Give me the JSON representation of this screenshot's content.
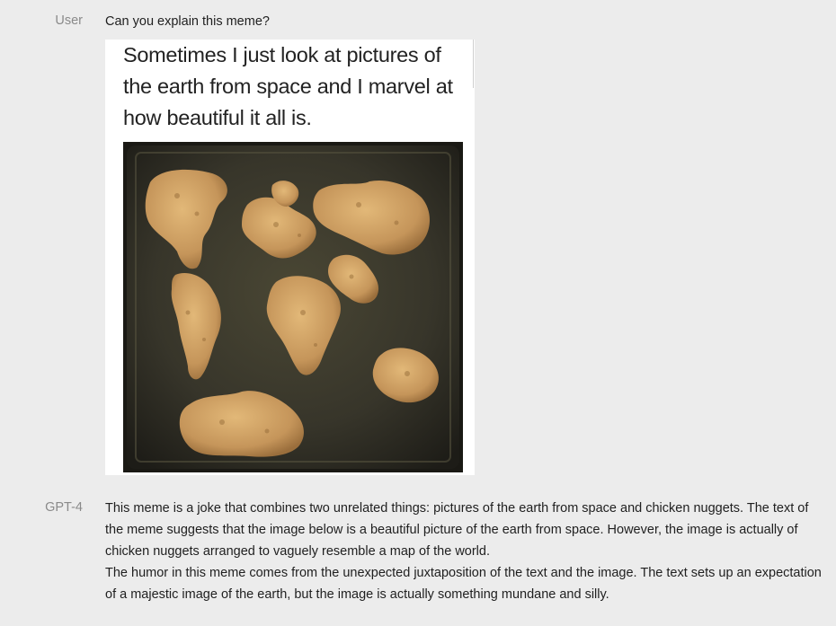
{
  "conversation": {
    "user": {
      "role_label": "User",
      "message": "Can you explain this meme?",
      "meme": {
        "caption": "Sometimes I just look at pictures of the earth from space and I marvel at how beautiful it all is."
      }
    },
    "assistant": {
      "role_label": "GPT-4",
      "paragraphs": [
        "This meme is a joke that combines two unrelated things: pictures of the earth from space and chicken nuggets. The text of the meme suggests that the image below is a beautiful picture of the earth from space. However, the image is actually of chicken nuggets arranged to vaguely resemble a map of the world.",
        "The humor in this meme comes from the unexpected juxtaposition of the text and the image. The text sets up an expectation of a majestic image of the earth, but the image is actually something mundane and silly."
      ]
    }
  },
  "colors": {
    "page_background": "#ececec",
    "role_label": "#8a8a8a",
    "text": "#1f1f1f",
    "tray": "#3a3a2c",
    "nugget": "#c99a5c"
  }
}
